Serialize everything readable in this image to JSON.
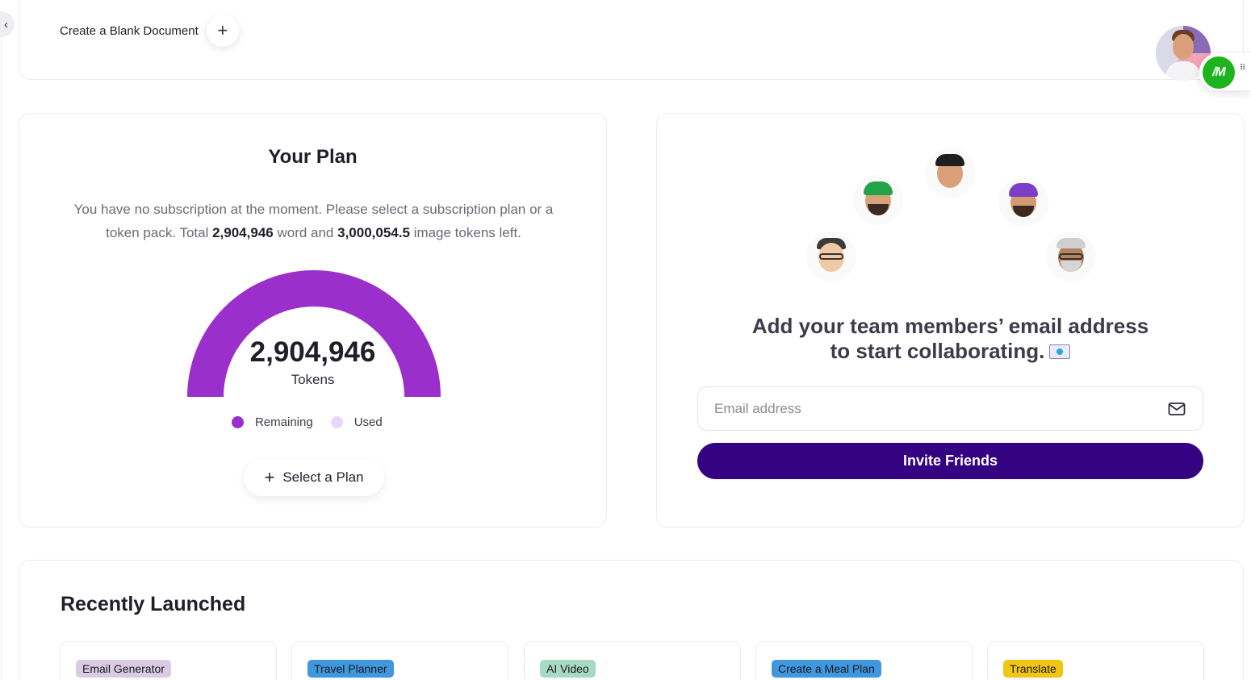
{
  "header": {
    "create_label": "Create a Blank Document",
    "create_icon": "plus-icon",
    "profile_badge": "/M"
  },
  "plan": {
    "title": "Your Plan",
    "desc_prefix": "You have no subscription at the moment. Please select a subscription plan or a token pack. Total ",
    "word_tokens": "2,904,946",
    "desc_mid": " word and ",
    "image_tokens": "3,000,054.5",
    "desc_suffix": " image tokens left.",
    "gauge_value": "2,904,946",
    "gauge_unit": "Tokens",
    "remaining_fraction": 1.0,
    "legend_remaining": "Remaining",
    "legend_used": "Used",
    "select_plan_label": "Select a Plan",
    "colors": {
      "remaining": "#9b2fcc",
      "used": "#ead6f6"
    }
  },
  "team": {
    "title_line1": "Add your team members’ email address",
    "title_line2": "to start collaborating.",
    "email_placeholder": "Email address",
    "invite_label": "Invite Friends",
    "accent": "#330382"
  },
  "recent": {
    "title": "Recently Launched",
    "items": [
      {
        "label": "Email Generator",
        "color": "#d9cbe1"
      },
      {
        "label": "Travel Planner",
        "color": "#3f97dd"
      },
      {
        "label": "AI Video",
        "color": "#a8d9c4"
      },
      {
        "label": "Create a Meal Plan",
        "color": "#3f97dd"
      },
      {
        "label": "Translate",
        "color": "#f0c514"
      }
    ]
  }
}
